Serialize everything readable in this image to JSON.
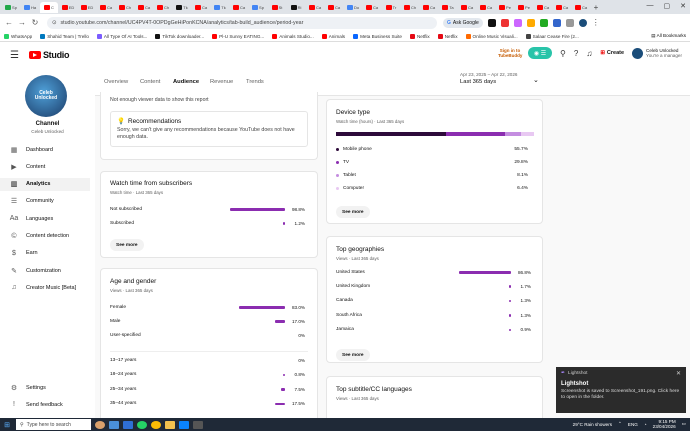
{
  "browser": {
    "tabs": [
      {
        "color": "#22a84a",
        "label": "Sp"
      },
      {
        "color": "#4285f4",
        "label": "Ha"
      },
      {
        "color": "#ff0000",
        "label": "C"
      },
      {
        "color": "#ff0000",
        "label": "ED"
      },
      {
        "color": "#ff0000",
        "label": "ED"
      },
      {
        "color": "#ff0000",
        "label": "Ca"
      },
      {
        "color": "#ff0000",
        "label": "Ch"
      },
      {
        "color": "#ff0000",
        "label": "Ca"
      },
      {
        "color": "#ff0000",
        "label": "Ch"
      },
      {
        "color": "#111111",
        "label": "Tk"
      },
      {
        "color": "#ff0000",
        "label": "Ca"
      },
      {
        "color": "#4285f4",
        "label": "Tk"
      },
      {
        "color": "#ff0000",
        "label": "Ca"
      },
      {
        "color": "#4285f4",
        "label": "Sp"
      },
      {
        "color": "#ff0000",
        "label": "St"
      },
      {
        "color": "#111111",
        "label": "Ri"
      },
      {
        "color": "#ff0000",
        "label": "Ca"
      },
      {
        "color": "#ff0000",
        "label": "Ca"
      },
      {
        "color": "#4285f4",
        "label": "Do"
      },
      {
        "color": "#ff0000",
        "label": "Ca"
      },
      {
        "color": "#ff0000",
        "label": "Tr"
      },
      {
        "color": "#ff0000",
        "label": "Ch"
      },
      {
        "color": "#ff0000",
        "label": "Ca"
      },
      {
        "color": "#ff0000",
        "label": "Ta"
      },
      {
        "color": "#ff0000",
        "label": "Ca"
      },
      {
        "color": "#ff0000",
        "label": "Ca"
      },
      {
        "color": "#ff0000",
        "label": "Pe"
      },
      {
        "color": "#ff0000",
        "label": "Pe"
      },
      {
        "color": "#ff0000",
        "label": "Ca"
      },
      {
        "color": "#ff0000",
        "label": "Ca"
      },
      {
        "color": "#ff0000",
        "label": "Ca"
      }
    ],
    "url": "studio.youtube.com/channel/UC4PV4T-0OPDgGeHiPonKCNA/analytics/tab-build_audience/period-year",
    "ask_google": "Ask Google",
    "bookmarks": [
      {
        "label": "WhatsApp",
        "color": "#25d366"
      },
      {
        "label": "Shahid Team | Trello",
        "color": "#0079bf"
      },
      {
        "label": "All Type Of AI Tools...",
        "color": "#7b5cff"
      },
      {
        "label": "TikTok downloader...",
        "color": "#111111"
      },
      {
        "label": "Pl-U Sunny EATING...",
        "color": "#ff0000"
      },
      {
        "label": "Animals Studio...",
        "color": "#ff0000"
      },
      {
        "label": "Animals",
        "color": "#ff0000"
      },
      {
        "label": "Meta Business Suite",
        "color": "#0866ff"
      },
      {
        "label": "Netflix",
        "color": "#e50914"
      },
      {
        "label": "Netflix",
        "color": "#e50914"
      },
      {
        "label": "Online Music Visuali...",
        "color": "#ff6a00"
      },
      {
        "label": "Salaar Cease Fire (2...",
        "color": "#444444"
      }
    ],
    "all_bookmarks": "All Bookmarks"
  },
  "header": {
    "logo_text": "Studio",
    "tubebuddy": "Sign in to TubeBuddy",
    "create_label": "Create",
    "channel_name": "Celeb Unlocked",
    "channel_role": "You're a manager"
  },
  "sidebar": {
    "avatar_text": "Celeb Unlocked",
    "title": "Channel",
    "subtitle": "Celeb Unlocked",
    "items": [
      {
        "label": "Dashboard",
        "icon": "▦"
      },
      {
        "label": "Content",
        "icon": "▶"
      },
      {
        "label": "Analytics",
        "icon": "▥"
      },
      {
        "label": "Community",
        "icon": "☰"
      },
      {
        "label": "Languages",
        "icon": "Aa"
      },
      {
        "label": "Content detection",
        "icon": "©"
      },
      {
        "label": "Earn",
        "icon": "$"
      },
      {
        "label": "Customization",
        "icon": "✎"
      },
      {
        "label": "Creator Music [Beta]",
        "icon": "♫"
      }
    ],
    "settings": "Settings",
    "feedback": "Send feedback"
  },
  "tabs": {
    "overview": "Overview",
    "content": "Content",
    "audience": "Audience",
    "revenue": "Revenue",
    "trends": "Trends"
  },
  "date_range": {
    "range": "Apr 23, 2025 – Apr 22, 2026",
    "period": "Last 365 days"
  },
  "not_enough": {
    "text": "Not enough viewer data to show this report",
    "rec_title": "Recommendations",
    "rec_text": "Sorry, we can't give any recommendations because YouTube does not have enough data."
  },
  "subscribers": {
    "title": "Watch time from subscribers",
    "sub": "Watch time · Last 365 days",
    "rows": [
      {
        "label": "Not subscribed",
        "value": "98.8%",
        "fraction": 0.988
      },
      {
        "label": "Subscribed",
        "value": "1.2%",
        "fraction": 0.012
      }
    ],
    "see_more": "See more"
  },
  "age_gender": {
    "title": "Age and gender",
    "sub": "Views · Last 365 days",
    "gender": [
      {
        "label": "Female",
        "value": "83.0%",
        "fraction": 0.83
      },
      {
        "label": "Male",
        "value": "17.0%",
        "fraction": 0.17
      },
      {
        "label": "User-specified",
        "value": "0%",
        "fraction": 0
      }
    ],
    "ages": [
      {
        "label": "13–17 years",
        "value": "0%",
        "fraction": 0
      },
      {
        "label": "18–24 years",
        "value": "0.8%",
        "fraction": 0.008
      },
      {
        "label": "25–34 years",
        "value": "7.5%",
        "fraction": 0.075
      },
      {
        "label": "35–44 years",
        "value": "17.5%",
        "fraction": 0.175
      }
    ]
  },
  "device": {
    "title": "Device type",
    "sub": "Watch time (hours) · Last 365 days",
    "rows": [
      {
        "label": "Mobile phone",
        "value": "55.7%",
        "fraction": 0.557,
        "color": "#2d0a3a"
      },
      {
        "label": "TV",
        "value": "29.8%",
        "fraction": 0.298,
        "color": "#8b2db0"
      },
      {
        "label": "Tablet",
        "value": "8.1%",
        "fraction": 0.081,
        "color": "#c48de0"
      },
      {
        "label": "Computer",
        "value": "6.4%",
        "fraction": 0.064,
        "color": "#e8c8f2"
      }
    ],
    "see_more": "See more"
  },
  "geo": {
    "title": "Top geographies",
    "sub": "Views · Last 365 days",
    "rows": [
      {
        "label": "United States",
        "value": "86.8%",
        "fraction": 0.868
      },
      {
        "label": "United Kingdom",
        "value": "1.7%",
        "fraction": 0.017
      },
      {
        "label": "Canada",
        "value": "1.3%",
        "fraction": 0.013
      },
      {
        "label": "South Africa",
        "value": "1.3%",
        "fraction": 0.013
      },
      {
        "label": "Jamaica",
        "value": "0.9%",
        "fraction": 0.009
      }
    ],
    "see_more": "See more"
  },
  "subtitle": {
    "title": "Top subtitle/CC languages",
    "sub": "Views · Last 365 days"
  },
  "toast": {
    "app": "Lightshot",
    "title": "Lightshot",
    "message": "Screenshot is saved to Screenshot_191.png. Click here to open in the folder."
  },
  "taskbar": {
    "search": "Type here to search",
    "weather": "29°C  Rain showers",
    "lang": "ENG",
    "time": "9:15 PM",
    "date": "23/04/2026"
  }
}
